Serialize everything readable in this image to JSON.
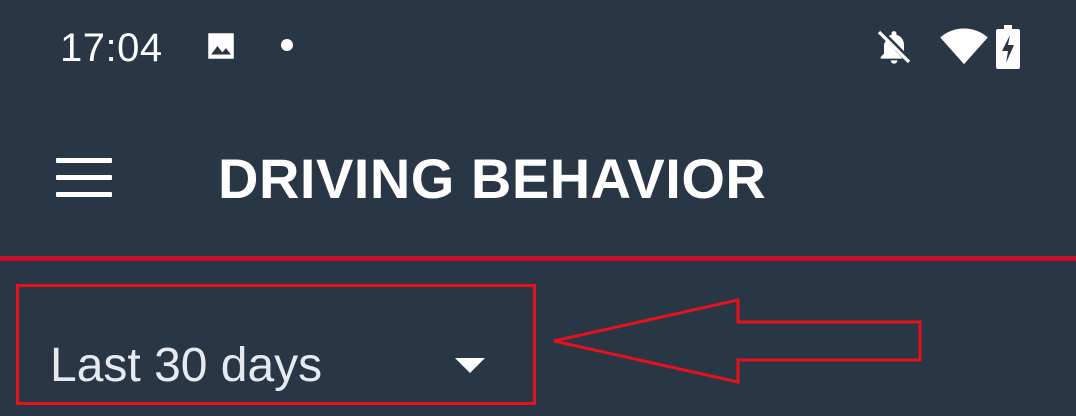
{
  "status_bar": {
    "time": "17:04",
    "icons": [
      "image-icon",
      "notification-dot",
      "bell-off-icon",
      "wifi-icon",
      "battery-charging-icon"
    ]
  },
  "app_bar": {
    "menu_icon": "hamburger-menu-icon",
    "title": "DRIVING BEHAVIOR"
  },
  "period_selector": {
    "selected": "Last 30 days",
    "icon": "dropdown-caret-icon"
  },
  "annotation": {
    "highlight_color": "#e5111c",
    "arrow": "left-arrow"
  },
  "colors": {
    "background": "#283646",
    "accent": "#c8102e",
    "annotation": "#e5111c",
    "text": "#ffffff"
  }
}
